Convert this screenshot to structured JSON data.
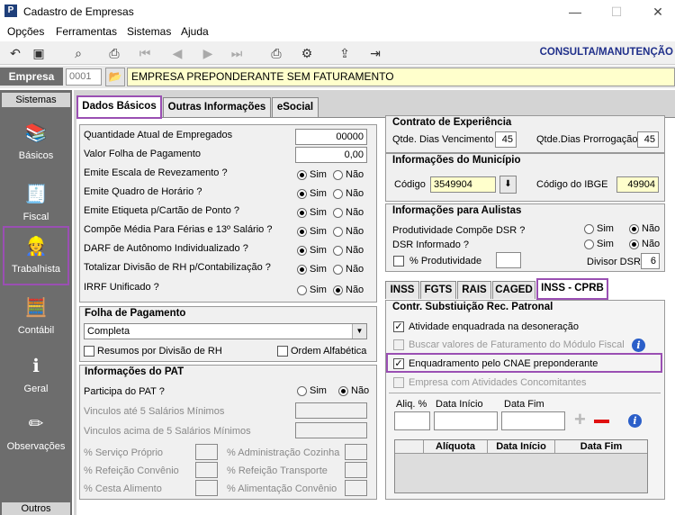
{
  "window": {
    "title": "Cadastro de Empresas",
    "icon_letter": "P"
  },
  "menu": [
    "Opções",
    "Ferramentas",
    "Sistemas",
    "Ajuda"
  ],
  "toolbar": {
    "mode_label": "CONSULTA/MANUTENÇÃO"
  },
  "empresa": {
    "label": "Empresa",
    "code": "0001",
    "name": "EMPRESA PREPONDERANTE SEM FATURAMENTO"
  },
  "sidebar": {
    "header": "Sistemas",
    "footer": "Outros",
    "items": [
      "Básicos",
      "Fiscal",
      "Trabalhista",
      "Contábil",
      "Geral",
      "Observações"
    ]
  },
  "tabs": [
    "Dados Básicos",
    "Outras Informações",
    "eSocial"
  ],
  "left": {
    "rows": [
      {
        "label": "Quantidade Atual de Empregados",
        "value": "00000"
      },
      {
        "label": "Valor Folha de Pagamento",
        "value": "0,00"
      }
    ],
    "yesno_labels": {
      "yes": "Sim",
      "no": "Não"
    },
    "radios": [
      {
        "label": "Emite Escala de Revezamento ?",
        "sel": "yes"
      },
      {
        "label": "Emite Quadro de Horário ?",
        "sel": "yes"
      },
      {
        "label": "Emite Etiqueta p/Cartão de Ponto ?",
        "sel": "yes"
      },
      {
        "label": "Compõe Média Para Férias e 13º Salário ?",
        "sel": "yes"
      },
      {
        "label": "DARF de Autônomo Individualizado ?",
        "sel": "yes"
      },
      {
        "label": "Totalizar Divisão de RH p/Contabilização ?",
        "sel": "yes"
      },
      {
        "label": "IRRF Unificado ?",
        "sel": "no"
      }
    ]
  },
  "folha": {
    "title": "Folha de Pagamento",
    "selected": "Completa",
    "chk1": "Resumos por Divisão de RH",
    "chk2": "Ordem Alfabética"
  },
  "pat": {
    "title": "Informações do PAT",
    "participa": "Participa do PAT ?",
    "lbl1": "Vinculos até 5 Salários Mínimos",
    "lbl2": "Vinculos acima de 5 Salários Mínimos",
    "pcts": [
      "% Serviço Próprio",
      "% Administração Cozinha",
      "% Refeição Convênio",
      "% Refeição Transporte",
      "% Cesta Alimento",
      "% Alimentação Convênio"
    ]
  },
  "contrato": {
    "title": "Contrato de Experiência",
    "venc_label": "Qtde. Dias Vencimento",
    "venc": "45",
    "prorr_label": "Qtde.Dias Prorrogação",
    "prorr": "45"
  },
  "municipio": {
    "title": "Informações do Município",
    "cod_label": "Código",
    "cod": "3549904",
    "ibge_label": "Código do IBGE",
    "ibge": "49904"
  },
  "aulistas": {
    "title": "Informações para Aulistas",
    "prod_label": "Produtividade Compõe DSR ?",
    "dsr_label": "DSR Informado ?",
    "pct_label": "% Produtividade",
    "div_label": "Divisor DSR",
    "div": "6"
  },
  "subtabs": [
    "INSS",
    "FGTS",
    "RAIS",
    "CAGED",
    "INSS - CPRB"
  ],
  "cprb": {
    "title": "Contr. Substiuição Rec. Patronal",
    "c1": "Atividade enquadrada na desoneração",
    "c2": "Buscar valores de Faturamento do Módulo Fiscal",
    "c3": "Enquadramento pelo CNAE preponderante",
    "c4": "Empresa com Atividades Concomitantes",
    "aliq": "Aliq. %",
    "ini": "Data Início",
    "fim": "Data Fim",
    "cols": [
      "Alíquota",
      "Data Início",
      "Data Fim"
    ]
  }
}
